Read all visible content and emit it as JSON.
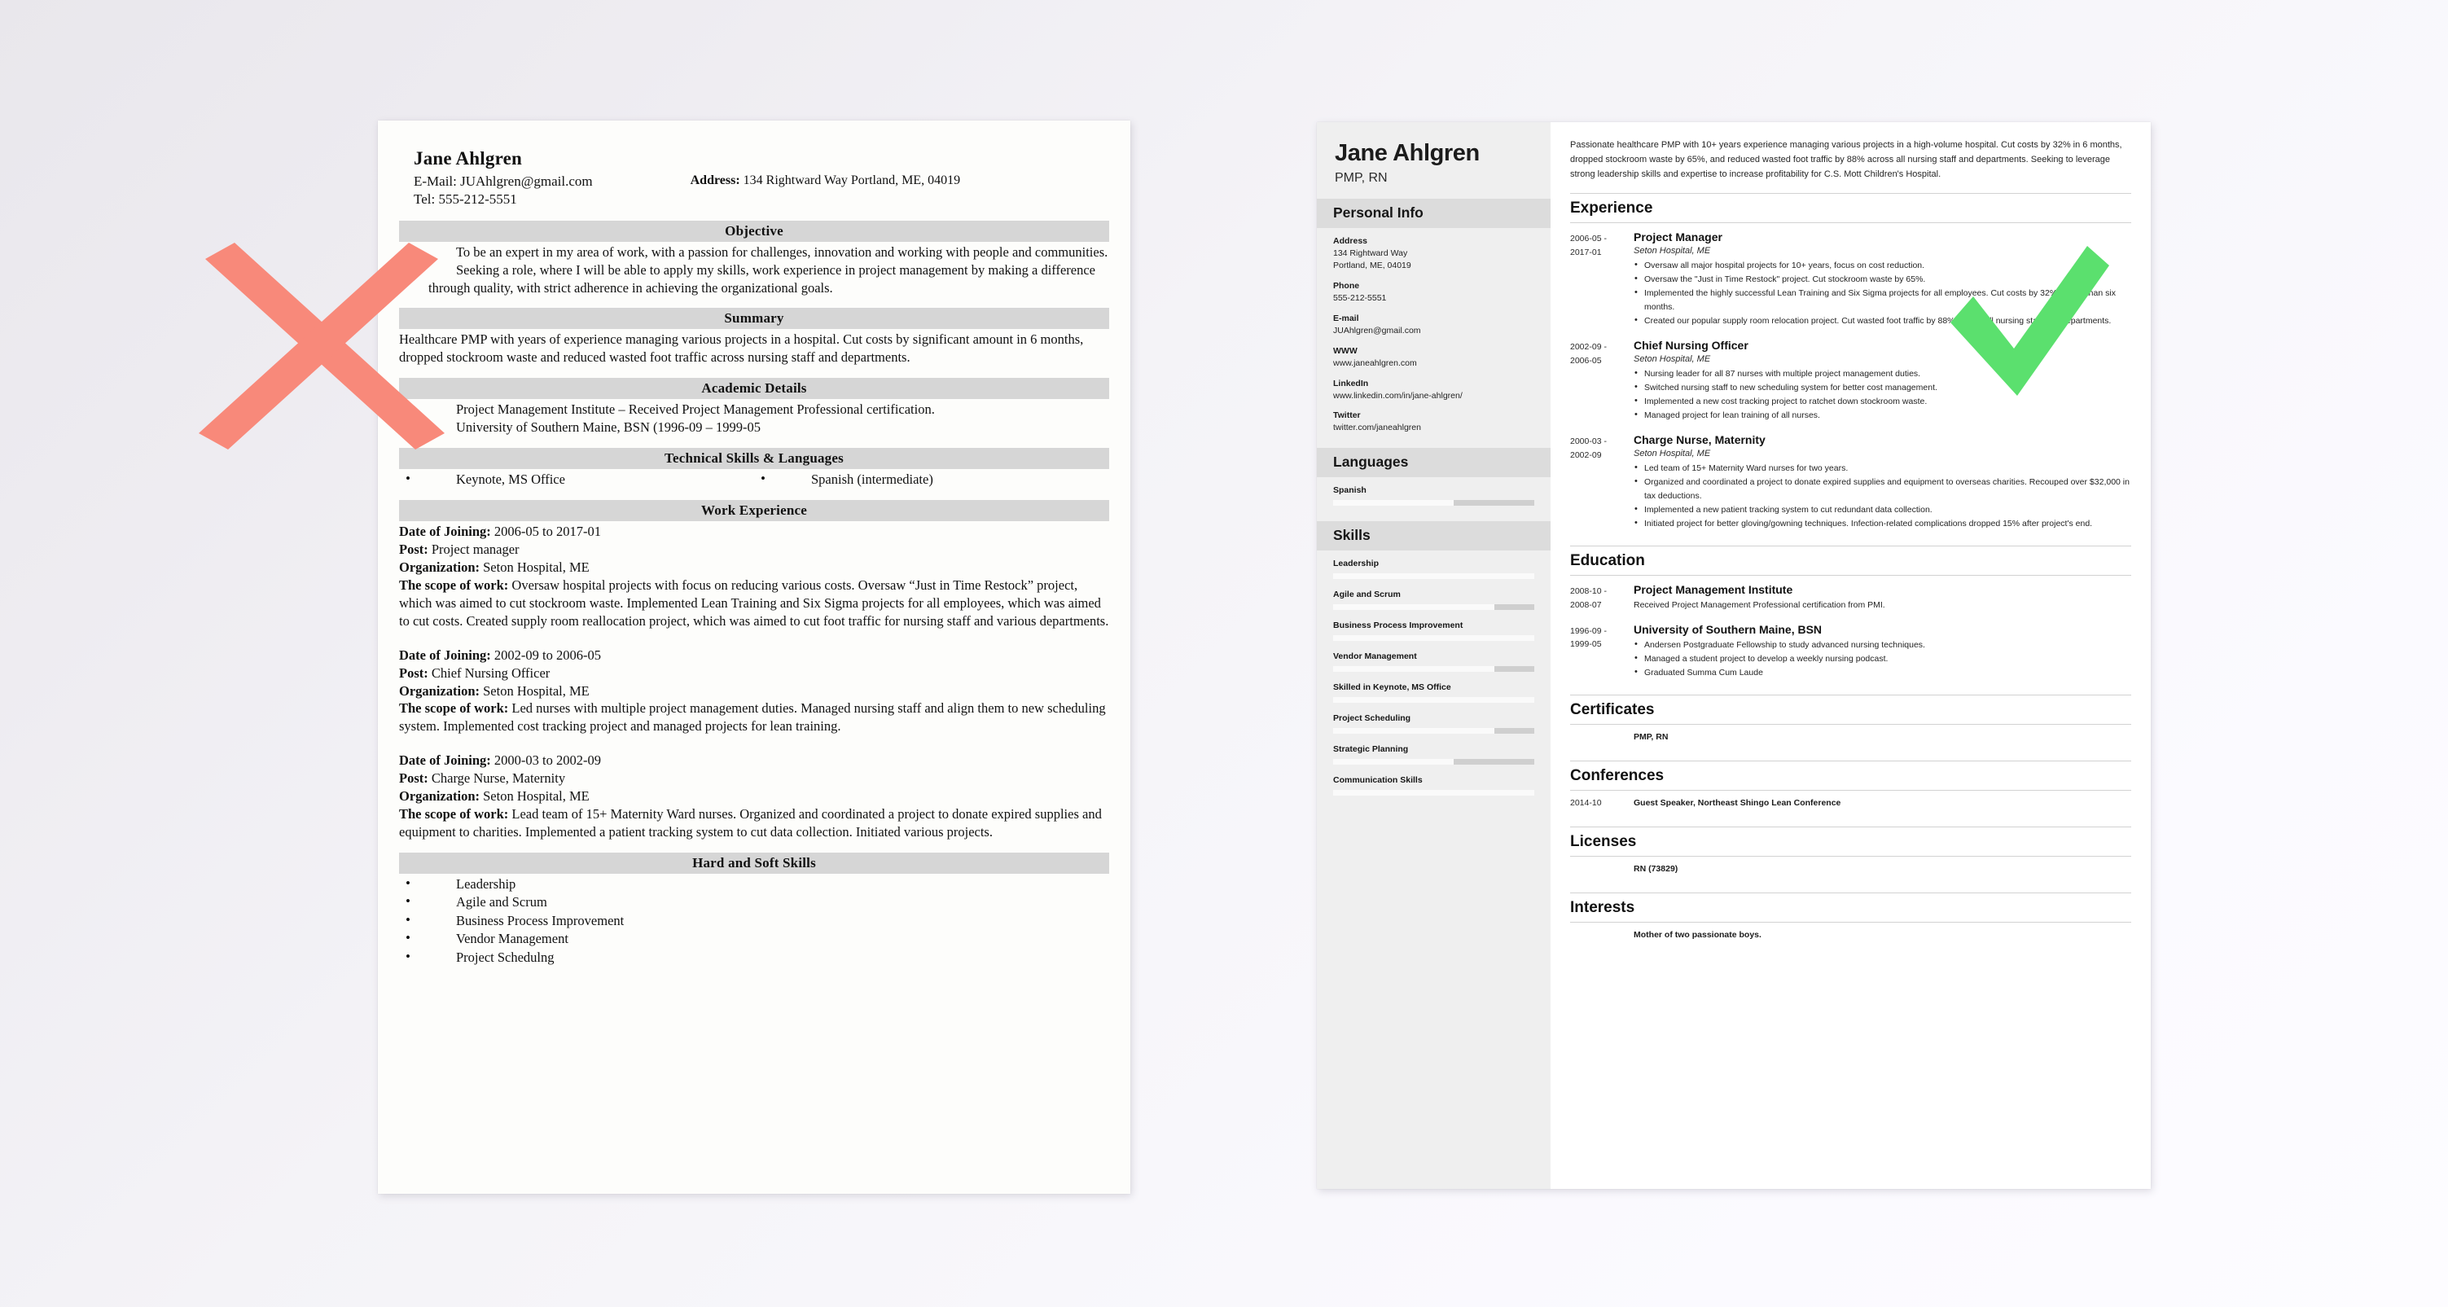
{
  "marks": {
    "bad_color": "#F8897A",
    "good_color": "#5BE06E",
    "bad_icon": "x-mark-icon",
    "good_icon": "check-mark-icon"
  },
  "bad_resume": {
    "name": "Jane Ahlgren",
    "email_line": "E-Mail: JUAhlgren@gmail.com",
    "tel_line": "Tel: 555-212-5551",
    "address_label": "Address:",
    "address_value": "134 Rightward Way Portland, ME, 04019",
    "objective": {
      "title": "Objective",
      "items": [
        "To be an expert in my area of work, with a passion for challenges, innovation and working with people and communities.",
        "Seeking a role, where I will be able to apply my skills, work experience in project management by making a difference through quality, with strict adherence in achieving the organizational goals."
      ]
    },
    "summary": {
      "title": "Summary",
      "text": "Healthcare PMP with years of experience managing various projects in a hospital. Cut costs by significant amount in 6 months, dropped stockroom waste and reduced wasted foot traffic across nursing staff and departments."
    },
    "academic": {
      "title": "Academic Details",
      "items": [
        "Project Management Institute – Received Project Management Professional certification.",
        "University of Southern Maine, BSN (1996-09 – 1999-05"
      ]
    },
    "technical": {
      "title": "Technical Skills & Languages",
      "left_item": "Keynote, MS Office",
      "right_item": "Spanish (intermediate)"
    },
    "work": {
      "title": "Work Experience",
      "labels": {
        "date": "Date of Joining:",
        "post": "Post:",
        "org": "Organization:",
        "scope": "The scope of work:"
      },
      "jobs": [
        {
          "date": "2006-05 to 2017-01",
          "post": "Project manager",
          "org": "Seton Hospital, ME",
          "scope": "Oversaw hospital projects with focus on reducing various costs. Oversaw “Just in Time Restock” project, which was aimed to cut stockroom waste. Implemented Lean Training and Six Sigma projects for all employees, which was aimed to cut costs. Created supply room reallocation project, which was aimed to cut foot traffic for nursing staff and various departments."
        },
        {
          "date": "2002-09 to 2006-05",
          "post": "Chief Nursing Officer",
          "org": "Seton Hospital, ME",
          "scope": "Led nurses with multiple project management duties. Managed nursing staff and align them to new scheduling system. Implemented cost tracking project and managed projects for lean training."
        },
        {
          "date": "2000-03 to 2002-09",
          "post": "Charge Nurse, Maternity",
          "org": "Seton Hospital, ME",
          "scope": "Lead team of 15+ Maternity Ward nurses. Organized and coordinated a project to donate expired supplies and equipment to charities. Implemented a patient tracking system to cut data collection. Initiated various projects."
        }
      ]
    },
    "hard_soft": {
      "title": "Hard and Soft Skills",
      "items": [
        "Leadership",
        "Agile and Scrum",
        "Business Process Improvement",
        "Vendor Management",
        "Project Schedulng"
      ]
    }
  },
  "good_resume": {
    "name": "Jane Ahlgren",
    "subtitle": "PMP, RN",
    "personal_info": {
      "title": "Personal Info",
      "fields": [
        {
          "label": "Address",
          "value": "134 Rightward Way\nPortland, ME, 04019"
        },
        {
          "label": "Phone",
          "value": "555-212-5551"
        },
        {
          "label": "E-mail",
          "value": "JUAhlgren@gmail.com"
        },
        {
          "label": "WWW",
          "value": "www.janeahlgren.com"
        },
        {
          "label": "LinkedIn",
          "value": "www.linkedin.com/in/jane-ahlgren/"
        },
        {
          "label": "Twitter",
          "value": "twitter.com/janeahlgren"
        }
      ]
    },
    "languages": {
      "title": "Languages",
      "items": [
        {
          "name": "Spanish",
          "level": 60
        }
      ]
    },
    "skills": {
      "title": "Skills",
      "items": [
        {
          "name": "Leadership",
          "level": 100
        },
        {
          "name": "Agile and Scrum",
          "level": 80
        },
        {
          "name": "Business Process Improvement",
          "level": 100
        },
        {
          "name": "Vendor Management",
          "level": 80
        },
        {
          "name": "Skilled in Keynote, MS Office",
          "level": 100
        },
        {
          "name": "Project Scheduling",
          "level": 80
        },
        {
          "name": "Strategic Planning",
          "level": 60
        },
        {
          "name": "Communication Skills",
          "level": 100
        }
      ]
    },
    "summary": "Passionate healthcare PMP with 10+ years experience managing various projects in a high-volume hospital. Cut costs by 32% in 6 months, dropped stockroom waste by 65%, and reduced wasted foot traffic by 88% across all nursing staff and departments. Seeking to leverage strong leadership skills and expertise to increase profitability for C.S. Mott Children's Hospital.",
    "experience": {
      "title": "Experience",
      "entries": [
        {
          "date": "2006-05 -\n2017-01",
          "title": "Project Manager",
          "org": "Seton Hospital, ME",
          "bullets": [
            "Oversaw all major hospital projects for 10+ years, focus on cost reduction.",
            "Oversaw the \"Just in Time Restock\" project. Cut stockroom waste by 65%.",
            "Implemented the highly successful Lean Training and Six Sigma projects for all employees. Cut costs by 32% in less than six months.",
            "Created our popular supply room relocation project. Cut wasted foot traffic by 88% across all nursing staff and departments."
          ]
        },
        {
          "date": "2002-09 -\n2006-05",
          "title": "Chief Nursing Officer",
          "org": "Seton Hospital, ME",
          "bullets": [
            "Nursing leader for all 87 nurses with multiple project management duties.",
            "Switched nursing staff to new scheduling system for better cost management.",
            "Implemented a new cost tracking project to ratchet down stockroom waste.",
            "Managed project for lean training of all nurses."
          ]
        },
        {
          "date": "2000-03 -\n2002-09",
          "title": "Charge Nurse, Maternity",
          "org": "Seton Hospital, ME",
          "bullets": [
            "Led team of 15+ Maternity Ward nurses for two years.",
            "Organized and coordinated a project to donate expired supplies and equipment to overseas charities. Recouped over $32,000 in tax deductions.",
            "Implemented a new patient tracking system to cut redundant data collection.",
            "Initiated project for better gloving/gowning techniques. Infection-related complications dropped 15% after project's end."
          ]
        }
      ]
    },
    "education": {
      "title": "Education",
      "entries": [
        {
          "date": "2008-10 -\n2008-07",
          "title": "Project Management Institute",
          "desc": "Received Project Management Professional certification from PMI.",
          "bullets": []
        },
        {
          "date": "1996-09 -\n1999-05",
          "title": "University of Southern Maine, BSN",
          "desc": "",
          "bullets": [
            "Andersen Postgraduate Fellowship to study advanced nursing techniques.",
            "Managed a student project to develop a weekly nursing podcast.",
            "Graduated Summa Cum Laude"
          ]
        }
      ]
    },
    "certificates": {
      "title": "Certificates",
      "rows": [
        {
          "date": "",
          "text": "PMP, RN"
        }
      ]
    },
    "conferences": {
      "title": "Conferences",
      "rows": [
        {
          "date": "2014-10",
          "text": "Guest Speaker, Northeast Shingo Lean Conference"
        }
      ]
    },
    "licenses": {
      "title": "Licenses",
      "rows": [
        {
          "date": "",
          "text": "RN (73829)"
        }
      ]
    },
    "interests": {
      "title": "Interests",
      "rows": [
        {
          "date": "",
          "text": "Mother of two passionate boys."
        }
      ]
    }
  }
}
